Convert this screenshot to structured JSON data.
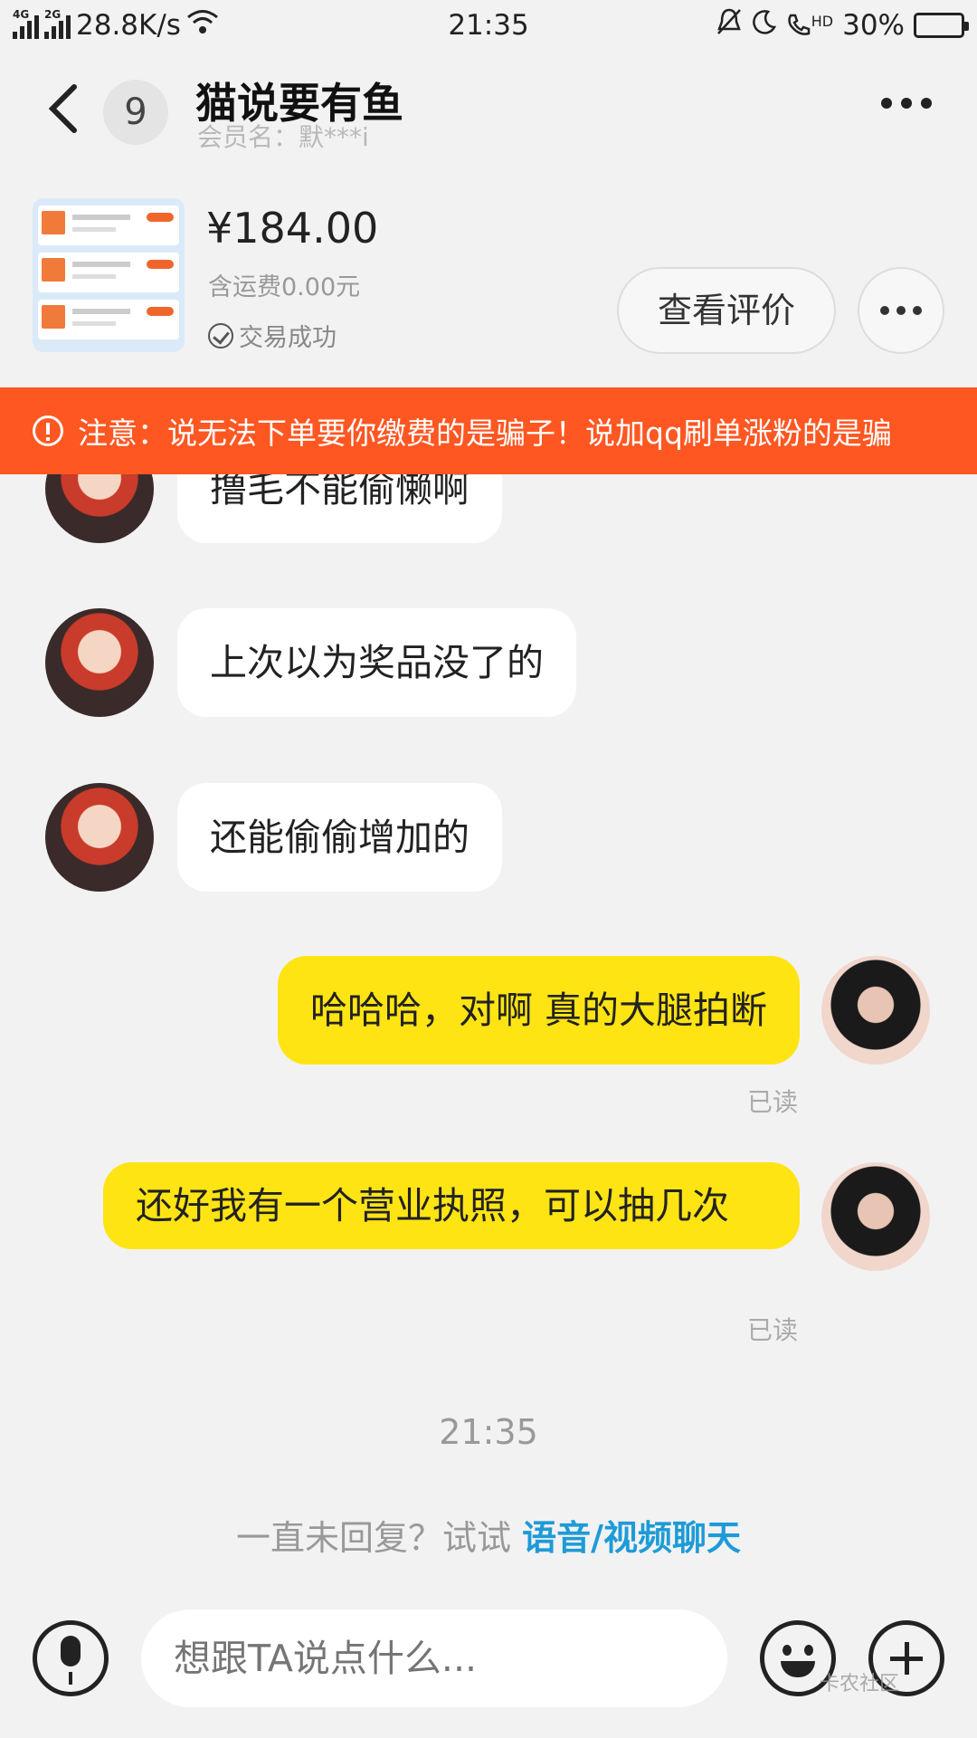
{
  "status_bar": {
    "net1": "4G",
    "net2": "2G",
    "speed": "28.8K/s",
    "time": "21:35",
    "hd": "HD",
    "battery": "30%"
  },
  "header": {
    "badge_count": "9",
    "title": "猫说要有鱼",
    "subtitle": "会员名：默***i"
  },
  "product": {
    "price": "¥184.00",
    "shipping": "含运费0.00元",
    "status": "交易成功",
    "review_label": "查看评价"
  },
  "warning": {
    "text": "注意：说无法下单要你缴费的是骗子！说加qq刷单涨粉的是骗"
  },
  "messages": [
    {
      "from": "other",
      "text": "撸毛不能偷懒啊"
    },
    {
      "from": "other",
      "text": "上次以为奖品没了的"
    },
    {
      "from": "other",
      "text": "还能偷偷增加的"
    },
    {
      "from": "me",
      "text": "哈哈哈，对啊 真的大腿拍断",
      "read": "已读"
    },
    {
      "from": "me",
      "text": "还好我有一个营业执照，可以抽几次",
      "read": "已读"
    }
  ],
  "timestamp": "21:35",
  "hint": {
    "prefix": "一直未回复？试试 ",
    "link": "语音/视频聊天"
  },
  "composer": {
    "placeholder": "想跟TA说点什么..."
  },
  "watermark": "卡农社区",
  "colors": {
    "accent_yellow": "#ffe414",
    "warning_orange": "#ff5722",
    "link_blue": "#1e9bd7"
  }
}
